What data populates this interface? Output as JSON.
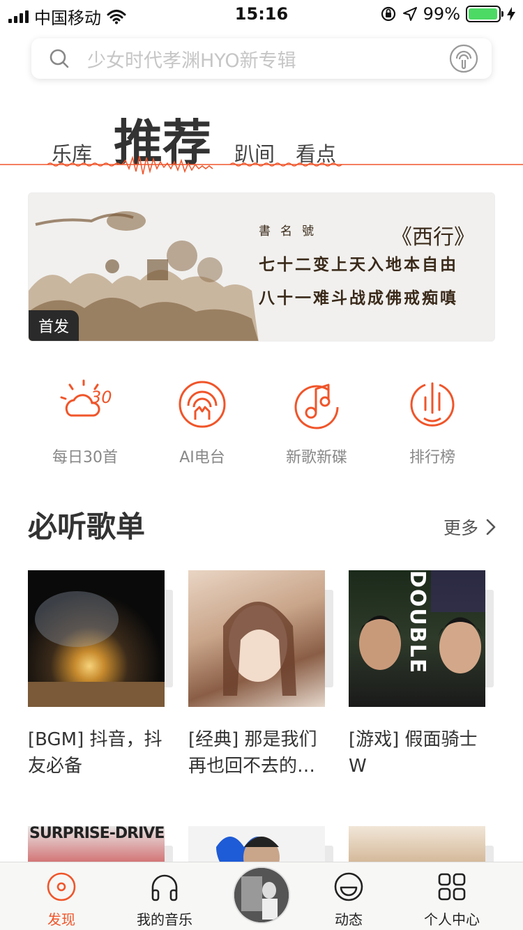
{
  "status_bar": {
    "carrier": "中国移动",
    "time": "15:16",
    "battery": "99%",
    "battery_level": 0.99
  },
  "search": {
    "placeholder": "少女时代孝渊HYO新专辑"
  },
  "tabs": [
    {
      "label": "乐库",
      "active": false
    },
    {
      "label": "推荐",
      "active": true
    },
    {
      "label": "趴间",
      "active": false
    },
    {
      "label": "看点",
      "active": false
    }
  ],
  "banner": {
    "tag": "首发",
    "sub": "書名號",
    "title": "《西行》",
    "line1": "七十二变上天入地本自由",
    "line2": "八十一难斗战成佛戒痴嗔"
  },
  "entries": [
    {
      "label": "每日30首",
      "icon": "daily-30-icon",
      "badge": "30"
    },
    {
      "label": "AI电台",
      "icon": "ai-radio-icon"
    },
    {
      "label": "新歌新碟",
      "icon": "new-album-icon"
    },
    {
      "label": "排行榜",
      "icon": "chart-rank-icon"
    }
  ],
  "section": {
    "title": "必听歌单",
    "more": "更多"
  },
  "playlists": [
    {
      "title": "[BGM] 抖音，抖友必备"
    },
    {
      "title": "[经典] 那是我们再也回不去的…"
    },
    {
      "title": "[游戏] 假面骑士W",
      "cover_text": "DOUBLE"
    },
    {
      "title": "",
      "cover_text": "SURPRISE-DRIVE"
    },
    {
      "title": ""
    },
    {
      "title": ""
    }
  ],
  "bottom_nav": [
    {
      "label": "发现",
      "icon": "discover-icon",
      "active": true
    },
    {
      "label": "我的音乐",
      "icon": "headphones-icon",
      "active": false
    },
    {
      "label": "动态",
      "icon": "smile-icon",
      "active": false
    },
    {
      "label": "个人中心",
      "icon": "grid-icon",
      "active": false
    }
  ],
  "colors": {
    "accent": "#f0552a",
    "placeholder": "#c6c6c6"
  }
}
